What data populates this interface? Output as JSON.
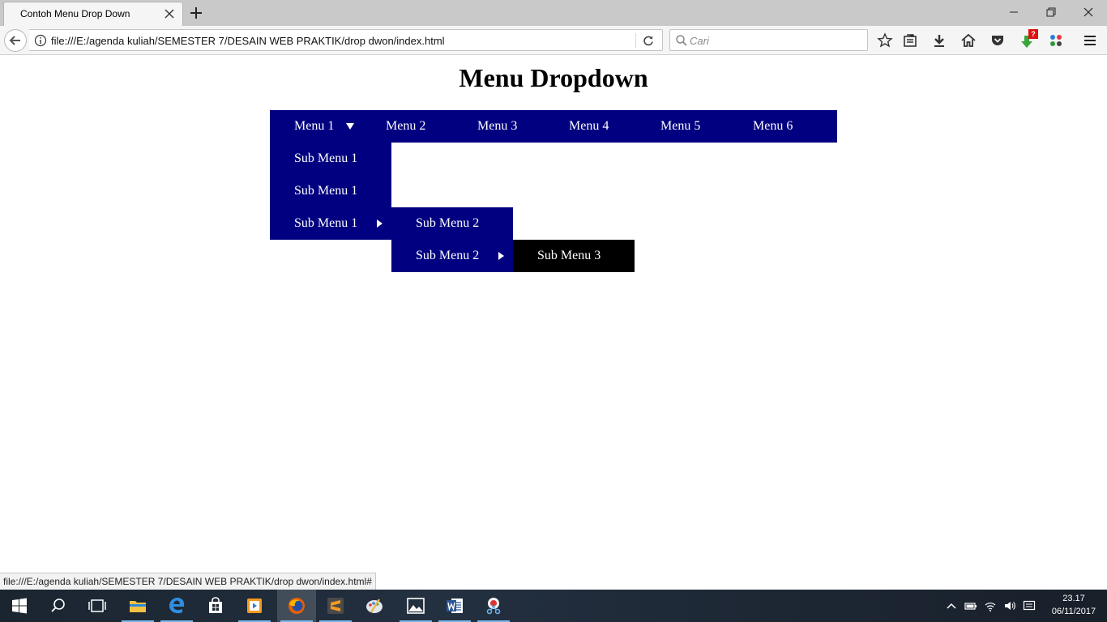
{
  "browser": {
    "tab_title": "Contoh Menu Drop Down",
    "url": "file:///E:/agenda kuliah/SEMESTER 7/DESAIN WEB PRAKTIK/drop dwon/index.html",
    "search_placeholder": "Cari",
    "status_url": "file:///E:/agenda kuliah/SEMESTER 7/DESAIN WEB PRAKTIK/drop dwon/index.html#",
    "notification_badge": "?"
  },
  "page": {
    "title": "Menu Dropdown",
    "menu": [
      {
        "label": "Menu 1"
      },
      {
        "label": "Menu 2"
      },
      {
        "label": "Menu 3"
      },
      {
        "label": "Menu 4"
      },
      {
        "label": "Menu 5"
      },
      {
        "label": "Menu 6"
      }
    ],
    "submenu1": [
      "Sub Menu 1",
      "Sub Menu 1",
      "Sub Menu 1"
    ],
    "submenu2": [
      "Sub Menu 2",
      "Sub Menu 2"
    ],
    "submenu3": [
      "Sub Menu 3"
    ]
  },
  "colors": {
    "menu_bg": "#000080",
    "submenu3_bg": "#000000",
    "text": "#ffffff"
  },
  "taskbar": {
    "time": "23.17",
    "date": "06/11/2017"
  }
}
